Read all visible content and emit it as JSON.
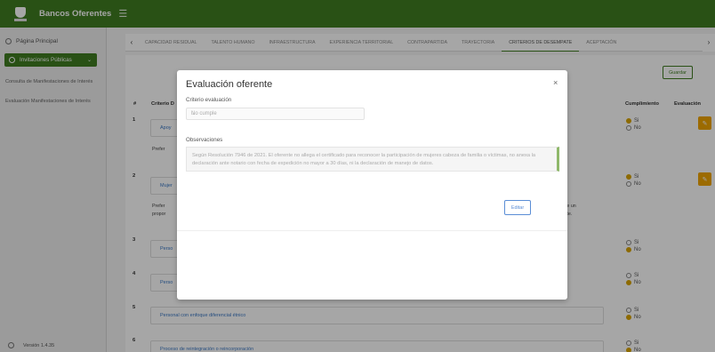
{
  "app": {
    "title": "Bancos Oferentes",
    "menu_icon": "hamburger-icon"
  },
  "sidebar": {
    "home": "Página Principal",
    "active": "Invitaciones Públicas",
    "sub_items": [
      "Consulta de Manifestaciones de Interés",
      "Evaluación Manifestaciones de Interés"
    ],
    "version": "Versión 1.4.35"
  },
  "tabs": {
    "items": [
      "CAPACIDAD RESIDUAL",
      "TALENTO HUMANO",
      "INFRAESTRUCTURA",
      "EXPERIENCIA TERRITORIAL",
      "CONTRAPARTIDA",
      "TRAYECTORIA",
      "CRITERIOS DE DESEMPATE",
      "ACEPTACIÓN"
    ],
    "active_index": 6
  },
  "table": {
    "save_label": "Guardar",
    "headers": {
      "num": "#",
      "criterion": "Criterio D",
      "cumplimiento": "Cumplimiento",
      "evaluacion": "Evaluación"
    },
    "rows": [
      {
        "num": "1",
        "label": "Apoy",
        "text": "Prefer",
        "right_text": "",
        "yes": "Si",
        "no": "No",
        "selected": "si"
      },
      {
        "num": "2",
        "label": "Mujer",
        "text": "Prefer\npropor",
        "right_text": "o, la de un\nlemente.",
        "yes": "Si",
        "no": "No",
        "selected": "si"
      },
      {
        "num": "3",
        "label": "Perso",
        "text": "",
        "right_text": "",
        "yes": "Si",
        "no": "No",
        "selected": "no"
      },
      {
        "num": "4",
        "label": "Perso",
        "text": "",
        "right_text": "",
        "yes": "Si",
        "no": "No",
        "selected": "no"
      },
      {
        "num": "5",
        "label": "Personal con enfoque diferencial étnico",
        "text": "",
        "right_text": "",
        "yes": "Si",
        "no": "No",
        "selected": "no"
      },
      {
        "num": "6",
        "label": "Proceso de reintegración o reincorporación",
        "text": "",
        "right_text": "",
        "yes": "Si",
        "no": "No",
        "selected": "no"
      }
    ]
  },
  "modal": {
    "title": "Evaluación oferente",
    "close": "×",
    "criterion_label": "Criterio evaluación",
    "criterion_value": "No cumple",
    "observations_label": "Observaciones",
    "observations_value": "Según Resolución 7946 de 2021. El oferente no allega el certificado para reconocer la participación de mujeres cabeza de familia o víctimas, no anexa la declaración ante notario con fecha de expedición no mayor a 30 días, ni la declaración de manejo de datos.",
    "edit_label": "Editar"
  },
  "colors": {
    "brand_green": "#3f7d21",
    "accent_orange": "#f0a500",
    "radio_on": "#d9a400",
    "link_blue": "#3a77c4"
  }
}
